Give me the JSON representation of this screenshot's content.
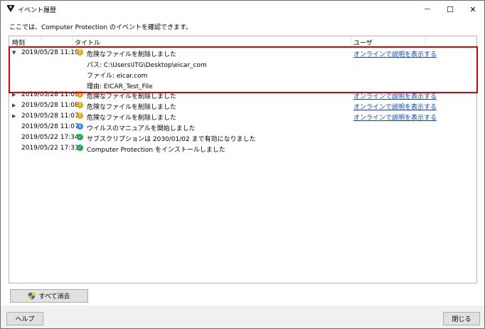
{
  "window": {
    "title": "イベント履歴",
    "controls": {
      "minimize": "—",
      "maximize": "☐",
      "close": "✕"
    }
  },
  "subtitle": "ここでは、Computer Protection のイベントを確認できます。",
  "columns": {
    "time": "時刻",
    "title": "タイトル",
    "user": "ユーザ"
  },
  "events": [
    {
      "expander": "▼",
      "time": "2019/05/28 11:19",
      "severity": "warning",
      "severity_glyph": "!",
      "title": "危険なファイルを削除しました",
      "link": "オンラインで説明を表示する",
      "details": [
        "パス: C:\\Users\\ITG\\Desktop\\eicar_com",
        "ファイル: eicar.com",
        "理由: EICAR_Test_File"
      ]
    },
    {
      "expander": "▶",
      "time": "2019/05/28 11:09",
      "severity": "warning",
      "severity_glyph": "!",
      "title": "危険なファイルを削除しました",
      "link": "オンラインで説明を表示する"
    },
    {
      "expander": "▶",
      "time": "2019/05/28 11:08",
      "severity": "warning",
      "severity_glyph": "!",
      "title": "危険なファイルを削除しました",
      "link": "オンラインで説明を表示する"
    },
    {
      "expander": "▶",
      "time": "2019/05/28 11:07",
      "severity": "warning",
      "severity_glyph": "!",
      "title": "危険なファイルを削除しました",
      "link": "オンラインで説明を表示する"
    },
    {
      "expander": "",
      "time": "2019/05/28 11:07",
      "severity": "info",
      "severity_glyph": "i",
      "title": "ウイルスのマニュアルを開始しました",
      "link": ""
    },
    {
      "expander": "",
      "time": "2019/05/22 17:34",
      "severity": "success",
      "severity_glyph": "✓",
      "title": "サブスクリプションは 2030/01/02 まで有効になりました",
      "link": ""
    },
    {
      "expander": "",
      "time": "2019/05/22 17:33",
      "severity": "success",
      "severity_glyph": "✓",
      "title": "Computer Protection をインストールしました",
      "link": ""
    }
  ],
  "buttons": {
    "clear_all": "すべて消去",
    "help": "ヘルプ",
    "close": "閉じる"
  },
  "colors": {
    "highlight": "#e40000",
    "link": "#0645c8",
    "warning": "#f0a10a",
    "info": "#1e90ff",
    "success": "#18a94a"
  }
}
